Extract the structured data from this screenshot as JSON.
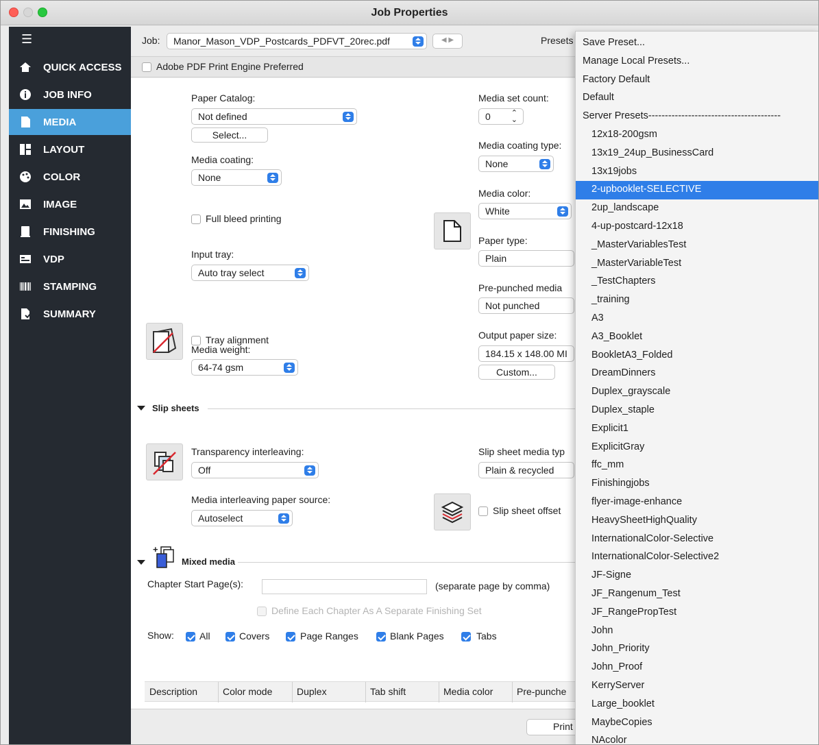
{
  "window": {
    "title": "Job Properties"
  },
  "sidebar": {
    "items": [
      {
        "label": "QUICK ACCESS",
        "icon": "home-icon"
      },
      {
        "label": "JOB INFO",
        "icon": "info-icon"
      },
      {
        "label": "MEDIA",
        "icon": "document-icon",
        "active": true
      },
      {
        "label": "LAYOUT",
        "icon": "layout-icon"
      },
      {
        "label": "COLOR",
        "icon": "palette-icon"
      },
      {
        "label": "IMAGE",
        "icon": "image-icon"
      },
      {
        "label": "FINISHING",
        "icon": "finishing-icon"
      },
      {
        "label": "VDP",
        "icon": "vdp-icon"
      },
      {
        "label": "STAMPING",
        "icon": "barcode-icon"
      },
      {
        "label": "SUMMARY",
        "icon": "summary-icon"
      }
    ]
  },
  "jobbar": {
    "job_label": "Job:",
    "job_value": "Manor_Mason_VDP_Postcards_PDFVT_20rec.pdf",
    "presets_label": "Presets"
  },
  "pdf_pref": {
    "label": "Adobe PDF Print Engine Preferred",
    "checked": false
  },
  "media": {
    "paper_catalog_label": "Paper Catalog:",
    "paper_catalog_value": "Not defined",
    "select_button": "Select...",
    "media_coating_label": "Media coating:",
    "media_coating_value": "None",
    "full_bleed_label": "Full bleed printing",
    "input_tray_label": "Input tray:",
    "input_tray_value": "Auto tray select",
    "tray_alignment_label": "Tray alignment",
    "media_weight_label": "Media weight:",
    "media_weight_value": "64-74 gsm",
    "media_set_count_label": "Media set count:",
    "media_set_count_value": "0",
    "media_coating_type_label": "Media coating type:",
    "media_coating_type_value": "None",
    "media_color_label": "Media color:",
    "media_color_value": "White",
    "paper_type_label": "Paper type:",
    "paper_type_value": "Plain",
    "pre_punched_label": "Pre-punched media",
    "pre_punched_value": "Not punched",
    "output_paper_size_label": "Output paper size:",
    "output_paper_size_value": "184.15 x 148.00 MI",
    "custom_button": "Custom..."
  },
  "slip_sheets": {
    "header": "Slip sheets",
    "transparency_label": "Transparency interleaving:",
    "transparency_value": "Off",
    "media_source_label": "Media interleaving paper source:",
    "media_source_value": "Autoselect",
    "slip_media_type_label": "Slip sheet media typ",
    "slip_media_type_value": "Plain & recycled",
    "slip_offset_label": "Slip sheet offset"
  },
  "mixed_media": {
    "header": "Mixed media",
    "chapter_label": "Chapter Start Page(s):",
    "chapter_value": "",
    "chapter_hint": "(separate page by comma)",
    "define_chapter_label": "Define Each Chapter As A Separate Finishing Set",
    "show_label": "Show:",
    "show_options": [
      {
        "label": "All",
        "checked": true
      },
      {
        "label": "Covers",
        "checked": true
      },
      {
        "label": "Page Ranges",
        "checked": true
      },
      {
        "label": "Blank Pages",
        "checked": true
      },
      {
        "label": "Tabs",
        "checked": true
      }
    ],
    "columns": [
      "Description",
      "Color mode",
      "Duplex",
      "Tab shift",
      "Media color",
      "Pre-punche"
    ]
  },
  "footer": {
    "print_button": "Print"
  },
  "presets_menu": {
    "top_items": [
      "Save Preset...",
      "Manage Local Presets...",
      "Factory Default",
      "Default",
      "Server Presets----------------------------------------"
    ],
    "server_presets": [
      "12x18-200gsm",
      "13x19_24up_BusinessCard",
      "13x19jobs",
      "2-upbooklet-SELECTIVE",
      "2up_landscape",
      "4-up-postcard-12x18",
      "_MasterVariablesTest",
      "_MasterVariableTest",
      "_TestChapters",
      "_training",
      "A3",
      "A3_Booklet",
      "BookletA3_Folded",
      "DreamDinners",
      "Duplex_grayscale",
      "Duplex_staple",
      "Explicit1",
      "ExplicitGray",
      "ffc_mm",
      "Finishingjobs",
      "flyer-image-enhance",
      "HeavySheetHighQuality",
      "InternationalColor-Selective",
      "InternationalColor-Selective2",
      "JF-Signe",
      "JF_Rangenum_Test",
      "JF_RangePropTest",
      "John",
      "John_Priority",
      "John_Proof",
      "KerryServer",
      "Large_booklet",
      "MaybeCopies",
      "NAcolor"
    ],
    "selected": "2-upbooklet-SELECTIVE"
  },
  "colors": {
    "accent": "#2f7ee8",
    "sidebar_bg": "#252a31",
    "sidebar_active": "#4aa0db"
  }
}
